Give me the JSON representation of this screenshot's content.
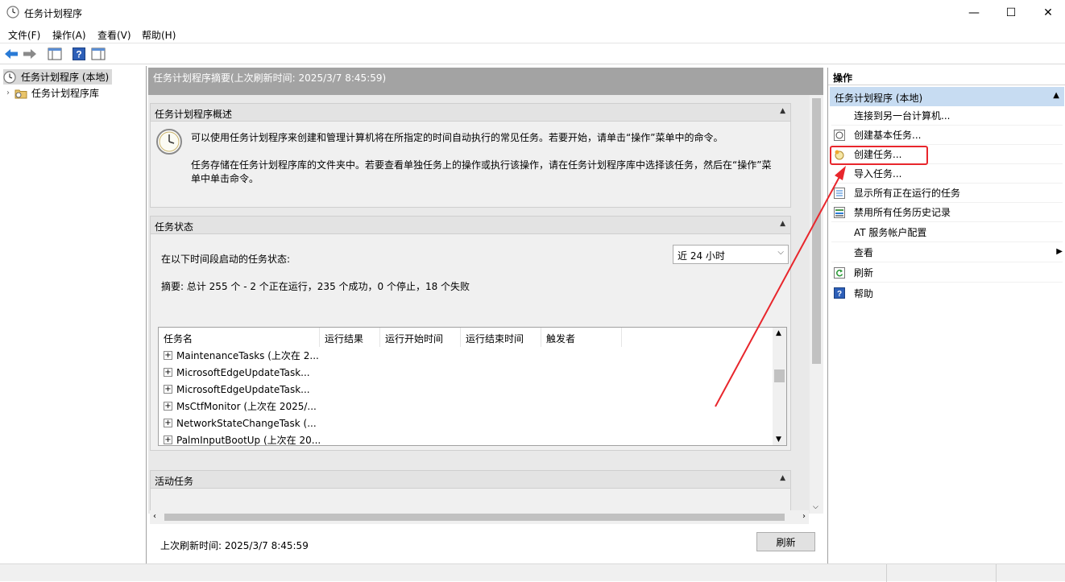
{
  "window": {
    "title": "任务计划程序",
    "minimize": "—",
    "maximize": "☐",
    "close": "✕"
  },
  "menu": [
    "文件(F)",
    "操作(A)",
    "查看(V)",
    "帮助(H)"
  ],
  "tree": {
    "root": "任务计划程序 (本地)",
    "library": "任务计划程序库"
  },
  "summary": {
    "header": "任务计划程序摘要(上次刷新时间: 2025/3/7 8:45:59)"
  },
  "overview": {
    "title": "任务计划程序概述",
    "para1": "可以使用任务计划程序来创建和管理计算机将在所指定的时间自动执行的常见任务。若要开始，请单击“操作”菜单中的命令。",
    "para2": "任务存储在任务计划程序库的文件夹中。若要查看单独任务上的操作或执行该操作，请在任务计划程序库中选择该任务，然后在“操作”菜单中单击命令。"
  },
  "status": {
    "title": "任务状态",
    "period_label": "在以下时间段启动的任务状态:",
    "period_value": "近 24 小时",
    "summary": "摘要: 总计 255 个 - 2 个正在运行，235 个成功，0 个停止，18 个失败",
    "columns": [
      "任务名",
      "运行结果",
      "运行开始时间",
      "运行结束时间",
      "触发者"
    ],
    "rows": [
      "MaintenanceTasks (上次在 2...",
      "MicrosoftEdgeUpdateTask...",
      "MicrosoftEdgeUpdateTask...",
      "MsCtfMonitor (上次在 2025/...",
      "NetworkStateChangeTask (...",
      "PalmInputBootUp (上次在 20..."
    ]
  },
  "active": {
    "title": "活动任务"
  },
  "footer": {
    "last_refresh": "上次刷新时间: 2025/3/7 8:45:59",
    "refresh_button": "刷新"
  },
  "actions": {
    "header": "操作",
    "group": "任务计划程序 (本地)",
    "items": [
      {
        "label": "连接到另一台计算机...",
        "icon": "none"
      },
      {
        "label": "创建基本任务...",
        "icon": "basic-task-icon"
      },
      {
        "label": "创建任务...",
        "icon": "create-task-icon"
      },
      {
        "label": "导入任务...",
        "icon": "none"
      },
      {
        "label": "显示所有正在运行的任务",
        "icon": "running-tasks-icon"
      },
      {
        "label": "禁用所有任务历史记录",
        "icon": "history-icon"
      },
      {
        "label": "AT 服务帐户配置",
        "icon": "none"
      },
      {
        "label": "查看",
        "icon": "none"
      },
      {
        "label": "刷新",
        "icon": "refresh-icon"
      },
      {
        "label": "帮助",
        "icon": "help-icon"
      }
    ]
  },
  "colors": {
    "highlight_box": "#e8262c",
    "group_bg": "#c7dcf2",
    "summary_bar": "#a3a3a3"
  }
}
